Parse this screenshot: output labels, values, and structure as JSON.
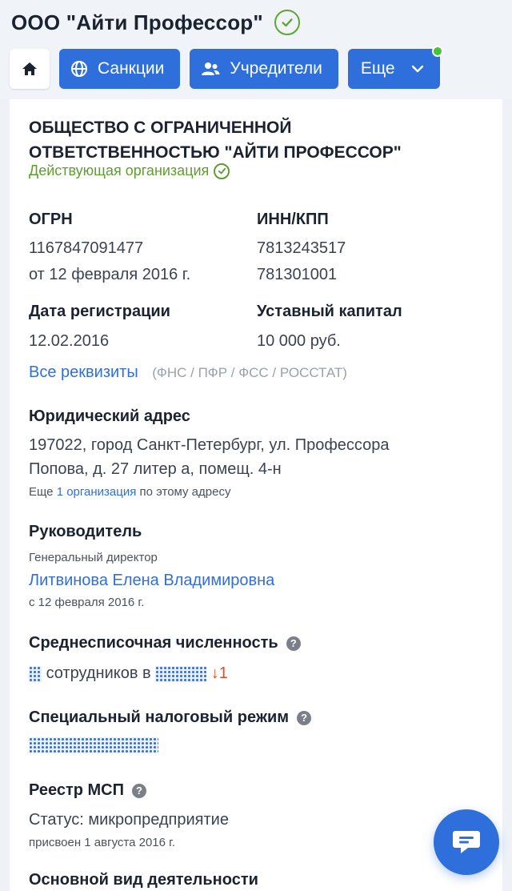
{
  "header": {
    "title": "ООО \"Айти Профессор\"",
    "tabs": [
      {
        "label": "Санкции",
        "icon": "globe-icon"
      },
      {
        "label": "Учредители",
        "icon": "users-icon"
      },
      {
        "label": "Еще",
        "icon": "chevron-down-icon"
      }
    ]
  },
  "company": {
    "full_name": "ОБЩЕСТВО С ОГРАНИЧЕННОЙ ОТВЕТСТВЕННОСТЬЮ \"АЙТИ ПРОФЕССОР\"",
    "status": "Действующая организация"
  },
  "ogrn": {
    "label": "ОГРН",
    "value": "1167847091477",
    "date": "от 12 февраля 2016 г."
  },
  "inn": {
    "label": "ИНН/КПП",
    "inn": "7813243517",
    "kpp": "781301001"
  },
  "registration": {
    "label": "Дата регистрации",
    "value": "12.02.2016"
  },
  "capital": {
    "label": "Уставный капитал",
    "value": "10 000 руб."
  },
  "requisites": {
    "link": "Все реквизиты",
    "sources": "(ФНС / ПФР / ФСС / РОССТАТ)"
  },
  "address": {
    "label": "Юридический адрес",
    "line1": "197022, город Санкт-Петербург, ул. Профессора",
    "line2": "Попова, д. 27 литер а, помещ. 4-н",
    "more_prefix": "Еще",
    "more_link": "1 организация",
    "more_suffix": "по этому адресу"
  },
  "director": {
    "label": "Руководитель",
    "position": "Генеральный директор",
    "name": "Литвинова Елена Владимировна",
    "since": "с 12 февраля 2016 г."
  },
  "employees": {
    "label": "Среднесписочная численность",
    "text": "сотрудников в",
    "trend": "↓1"
  },
  "tax_regime": {
    "label": "Специальный налоговый режим"
  },
  "msp": {
    "label": "Реестр МСП",
    "status": "Статус: микропредприятие",
    "assigned": "присвоен 1 августа 2016 г."
  },
  "activity": {
    "label": "Основной вид деятельности"
  },
  "colors": {
    "accent": "#2f6fdc",
    "success": "#5d9f2d",
    "alert": "#e24a2a"
  }
}
